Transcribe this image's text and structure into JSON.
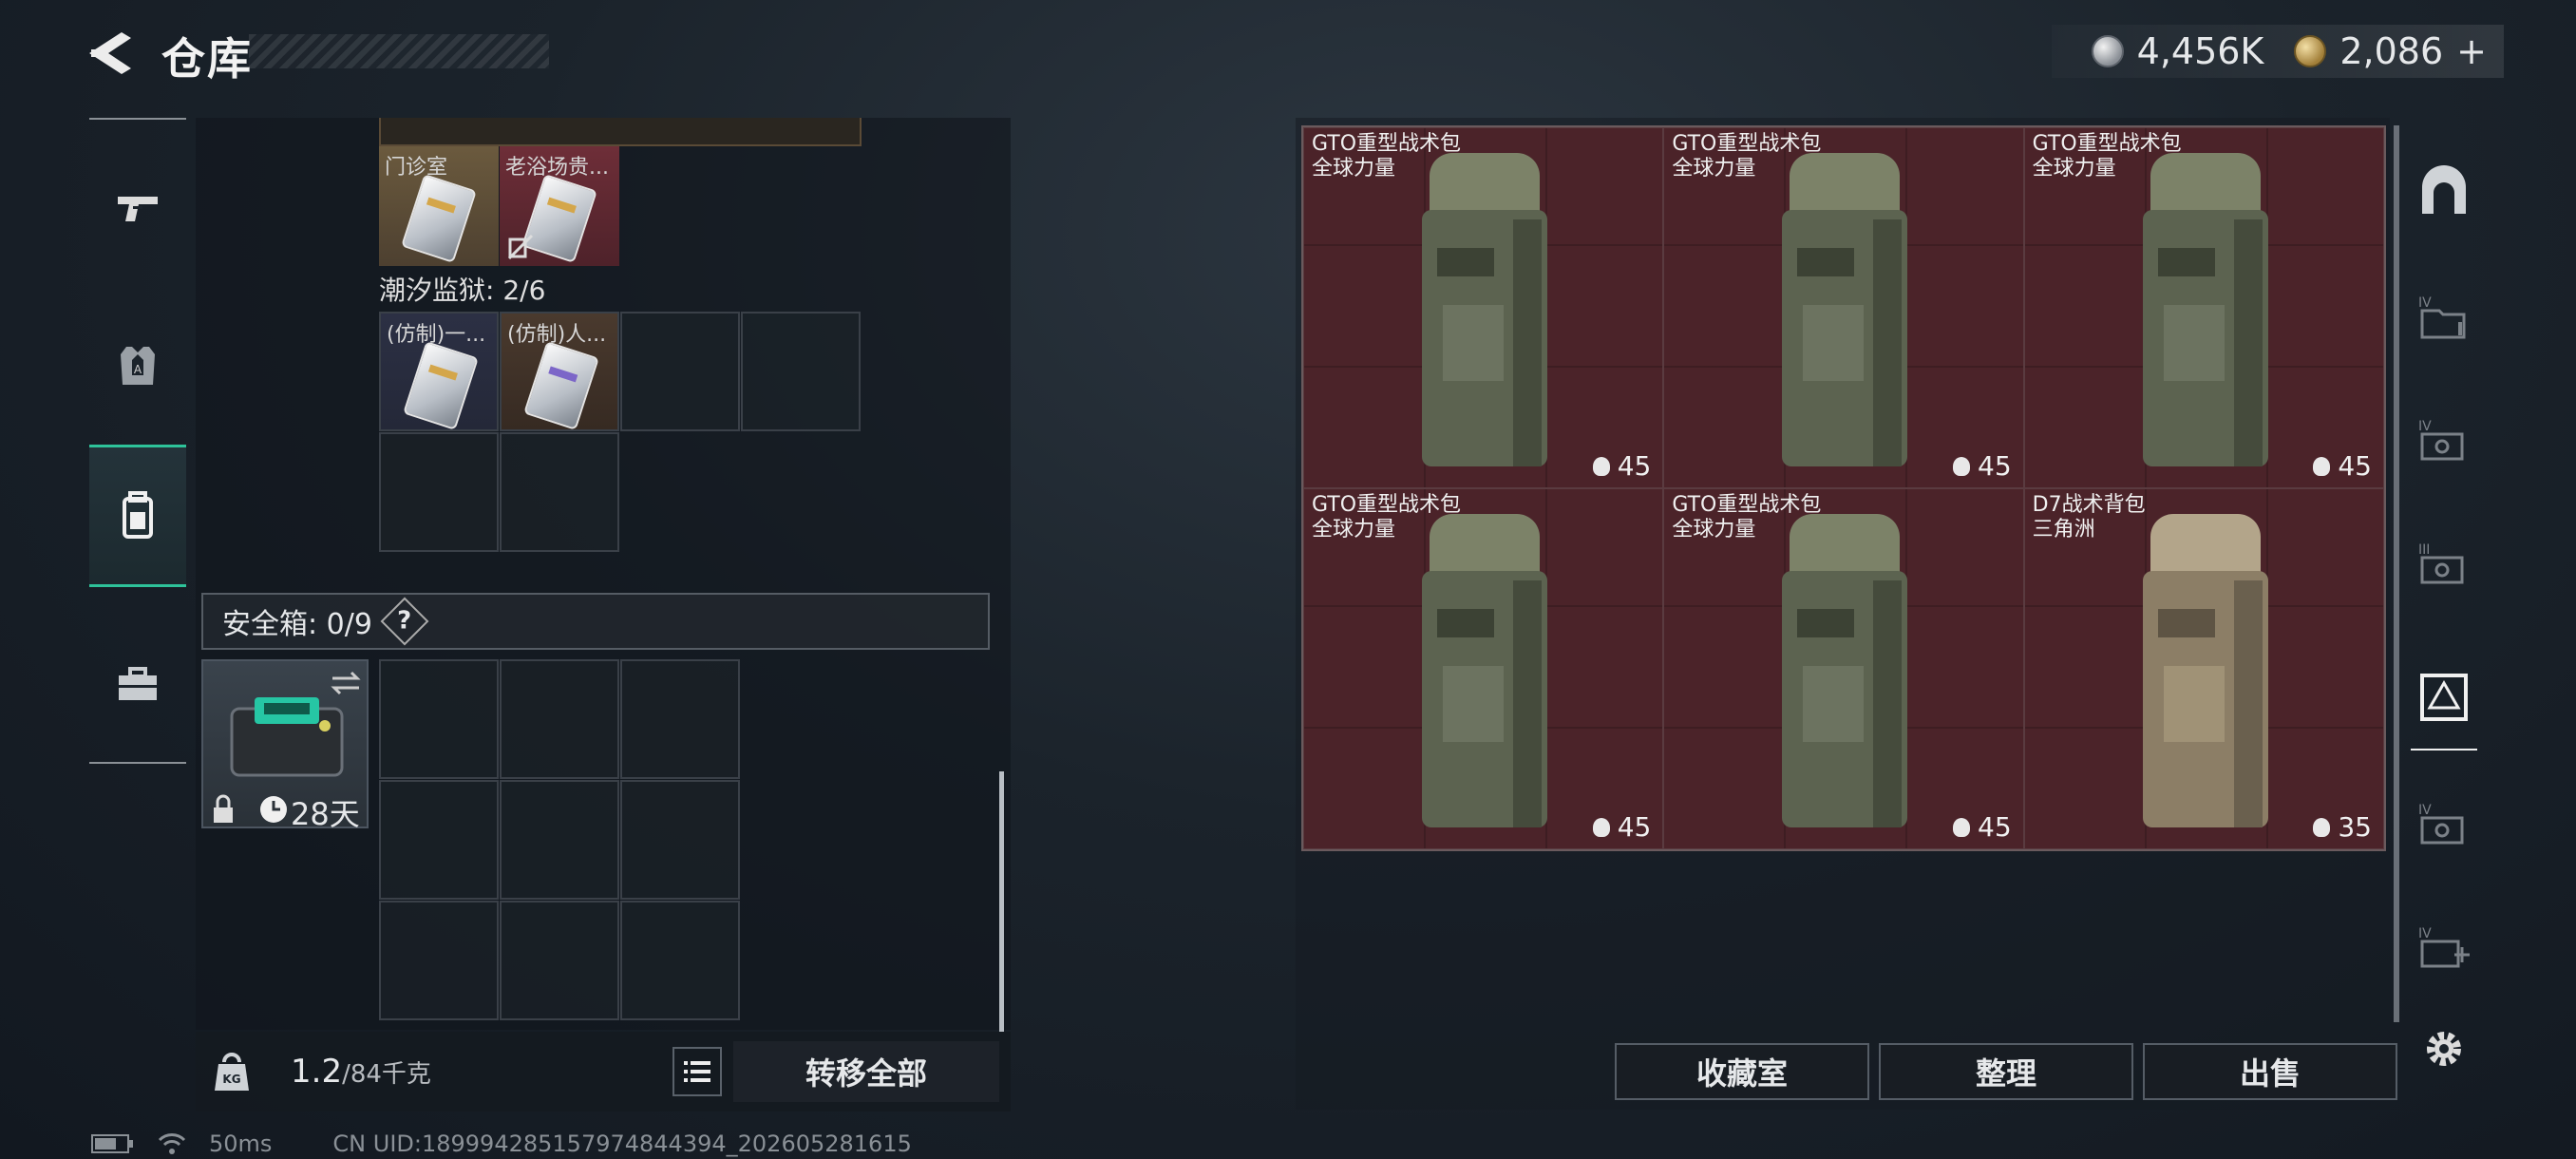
{
  "header": {
    "title": "仓库"
  },
  "currency": {
    "silver": "4,456K",
    "gold": "2,086",
    "plus": "+"
  },
  "version_text": "",
  "left_nav": [
    "weapons",
    "armor",
    "backpack",
    "toolbox"
  ],
  "items": {
    "top": [
      {
        "label": "门诊室",
        "style": "silver"
      },
      {
        "label": "老浴场贵...",
        "style": "red"
      }
    ],
    "prison_label": "潮汐监狱: 2/6",
    "prison": [
      {
        "label": "(仿制)一...",
        "style": "navy"
      },
      {
        "label": "(仿制)人...",
        "style": "brown"
      }
    ]
  },
  "safe": {
    "label": "安全箱: 0/9",
    "help": "?",
    "days": "28天"
  },
  "bottom": {
    "weight": "1.2",
    "weight_max": "/84千克",
    "transfer_all": "转移全部"
  },
  "status": {
    "ping": "50ms",
    "uid": "CN UID:1899942851579748443​94_202605281615"
  },
  "stash": [
    {
      "name": "GTO重型战术包",
      "sub": "全球力量",
      "count": "45",
      "tone": "green"
    },
    {
      "name": "GTO重型战术包",
      "sub": "全球力量",
      "count": "45",
      "tone": "green"
    },
    {
      "name": "GTO重型战术包",
      "sub": "全球力量",
      "count": "45",
      "tone": "green"
    },
    {
      "name": "GTO重型战术包",
      "sub": "全球力量",
      "count": "45",
      "tone": "green"
    },
    {
      "name": "GTO重型战术包",
      "sub": "全球力量",
      "count": "45",
      "tone": "green"
    },
    {
      "name": "D7战术背包",
      "sub": "三角洲",
      "count": "35",
      "tone": "tan"
    }
  ],
  "actions": {
    "collection": "收藏室",
    "sort": "整理",
    "sell": "出售"
  },
  "rail": [
    {
      "icon": "vault-icon"
    },
    {
      "icon": "folder-iv-icon",
      "roman": "IV"
    },
    {
      "icon": "card-iv-icon",
      "roman": "IV"
    },
    {
      "icon": "card-iii-icon",
      "roman": "III"
    },
    {
      "icon": "safe-box-icon"
    },
    {
      "icon": "card-iv-2-icon",
      "roman": "IV"
    },
    {
      "icon": "card-iv-add-icon",
      "roman": "IV"
    }
  ]
}
